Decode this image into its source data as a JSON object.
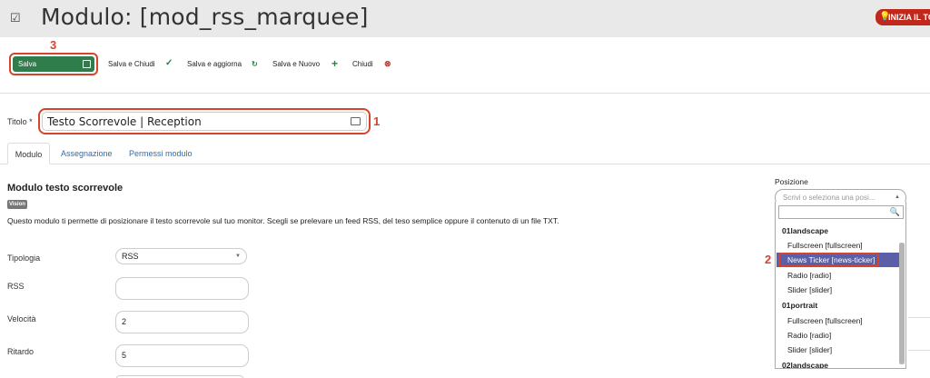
{
  "header": {
    "title": "Modulo: [mod_rss_marquee]",
    "tour_label": "INIZIA IL TOUR",
    "tour_color": "#c0281c"
  },
  "toolbar": {
    "save_label": "Salva",
    "save_close_label": "Salva e Chiudi",
    "save_update_label": "Salva e aggiorna",
    "save_new_label": "Salva e Nuovo",
    "close_label": "Chiudi",
    "save_color": "#2f7d4a"
  },
  "annotations": [
    "1",
    "2",
    "3"
  ],
  "form": {
    "title_label": "Titolo *",
    "title_value": "Testo Scorrevole | Reception"
  },
  "tabs": [
    "Modulo",
    "Assegnazione",
    "Permessi modulo"
  ],
  "module": {
    "heading": "Modulo testo scorrevole",
    "badge": "Vision",
    "description": "Questo modulo ti permette di posizionare il testo scorrevole sul tuo monitor. Scegli se prelevare un feed RSS, del teso semplice oppure il contenuto di un file TXT.",
    "fields": [
      {
        "label": "Tipologia",
        "value": "RSS"
      },
      {
        "label": "RSS",
        "value": ""
      },
      {
        "label": "Velocità",
        "value": "2"
      },
      {
        "label": "Ritardo",
        "value": "5"
      }
    ]
  },
  "position": {
    "label": "Posizione",
    "placeholder": "Scrivi o seleziona una posi...",
    "groups": [
      {
        "name": "01landscape",
        "options": [
          "Fullscreen [fullscreen]",
          "News Ticker [news-ticker]",
          "Radio [radio]",
          "Slider [slider]"
        ]
      },
      {
        "name": "01portrait",
        "options": [
          "Fullscreen [fullscreen]",
          "Radio [radio]",
          "Slider [slider]"
        ]
      },
      {
        "name": "02landscape",
        "options": []
      }
    ],
    "selected": "News Ticker [news-ticker]",
    "highlight_color": "#5b5fa8"
  }
}
